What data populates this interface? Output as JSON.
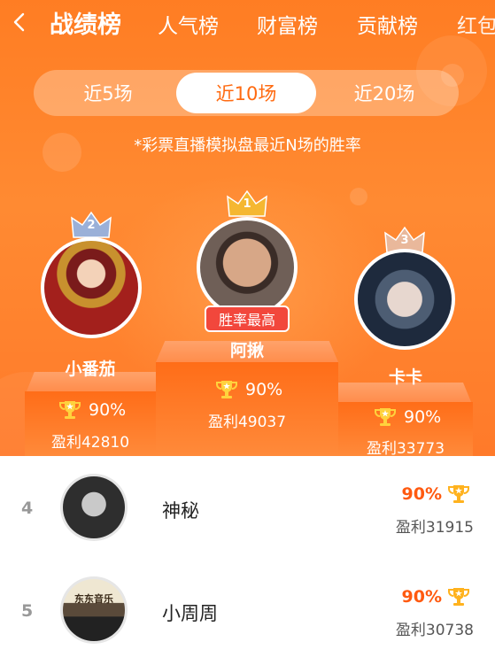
{
  "nav": {
    "tabs": [
      {
        "label": "战绩榜",
        "active": true
      },
      {
        "label": "人气榜",
        "active": false
      },
      {
        "label": "财富榜",
        "active": false
      },
      {
        "label": "贡献榜",
        "active": false
      },
      {
        "label": "红包",
        "active": false
      }
    ],
    "back_icon": "chevron-left-icon"
  },
  "segment": {
    "options": [
      {
        "label": "近5场",
        "active": false
      },
      {
        "label": "近10场",
        "active": true
      },
      {
        "label": "近20场",
        "active": false
      }
    ]
  },
  "note": "*彩票直播模拟盘最近N场的胜率",
  "podium": {
    "first": {
      "rank": "1",
      "name": "阿揪",
      "rate": "90%",
      "profit": "盈利49037",
      "badge": "胜率最高"
    },
    "second": {
      "rank": "2",
      "name": "小番茄",
      "rate": "90%",
      "profit": "盈利42810"
    },
    "third": {
      "rank": "3",
      "name": "卡卡",
      "rate": "90%",
      "profit": "盈利33773"
    }
  },
  "list": [
    {
      "rank": "4",
      "name": "神秘",
      "rate": "90%",
      "profit": "盈利31915"
    },
    {
      "rank": "5",
      "name": "小周周",
      "rate": "90%",
      "profit": "盈利30738",
      "avatar_sign": "东东音乐"
    }
  ],
  "colors": {
    "accent": "#ff7d23",
    "rate_text": "#ff5a10",
    "badge": "#f2473c",
    "crown_gold": "#f5b731",
    "crown_silver": "#9ab0d8",
    "crown_bronze": "#e9b89b"
  }
}
